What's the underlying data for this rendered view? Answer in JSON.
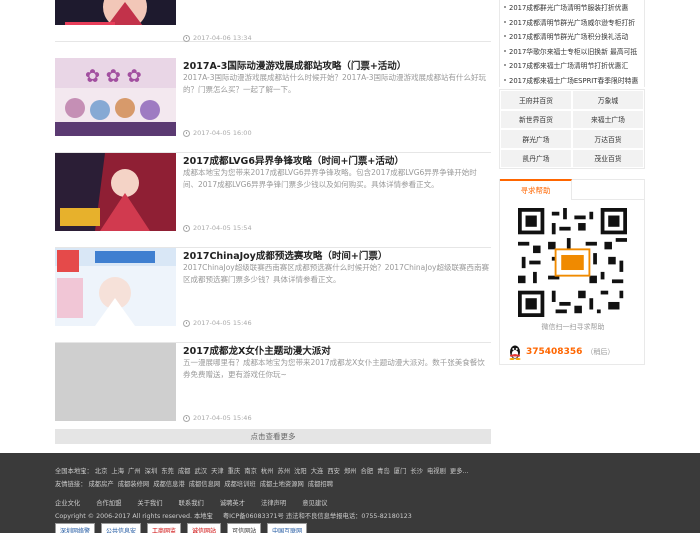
{
  "articles": [
    {
      "title": "",
      "summary": "",
      "date": "2017-04-06 13:34"
    },
    {
      "title": "2017A-3国际动漫游戏展成都站攻略（门票+活动）",
      "summary": "2017A-3国际动漫游戏展成都站什么时候开始？2017A-3国际动漫游戏展成都站有什么好玩的？门票怎么买？一起了解一下。",
      "date": "2017-04-05 16:00"
    },
    {
      "title": "2017成都LVG6异界争锋攻略（时间+门票+活动）",
      "summary": "成都本地宝为您带来2017成都LVG6异界争锋攻略。包含2017成都LVG6异界争锋开始时间、2017成都LVG6异界争锋门票多少钱以及如何购买。具体详情参看正文。",
      "date": "2017-04-05 15:54"
    },
    {
      "title": "2017ChinaJoy成都预选赛攻略（时间+门票）",
      "summary": "2017ChinaJoy超级联赛西南赛区成都预选赛什么时候开始？2017ChinaJoy超级联赛西南赛区成都预选赛门票多少钱？具体详情参看正文。",
      "date": "2017-04-05 15:46"
    },
    {
      "title": "2017成都龙X女仆主题动漫大派对",
      "summary": "五一漫展哪里有？成都本地宝为您带来2017成都龙X女仆主题动漫大派对。数千张美食餐饮券免费赠送，更有游戏任你玩~",
      "date": "2017-04-05 15:46"
    }
  ],
  "load_more": "点击查看更多",
  "sidebar": {
    "news": [
      "2017成都群光广场清明节服装打折优惠",
      "2017成都清明节群光广场威尔逊专柜打折",
      "2017成都清明节群光广场积分换礼活动",
      "2017华歌尔来福士专柜以旧换新 最高可抵",
      "2017成都来福士广场清明节打折优惠汇",
      "2017成都来福士广场ESPRIT春季限时特惠"
    ],
    "malls": [
      "王府井百货",
      "万象城",
      "新世界百货",
      "来福士广场",
      "群光广场",
      "万达百货",
      "凯丹广场",
      "茂业百货"
    ],
    "help": {
      "tab": "寻求帮助",
      "qr_caption": "微信扫一扫寻求帮助",
      "qq": "375408356",
      "qq_note": "（稍后）"
    }
  },
  "footer": {
    "cities_label": "全国本地宝：",
    "cities": [
      "北京",
      "上海",
      "广州",
      "深圳",
      "东莞",
      "成都",
      "武汉",
      "天津",
      "重庆",
      "南京",
      "杭州",
      "苏州",
      "沈阳",
      "大连",
      "西安",
      "郑州",
      "合肥",
      "青岛",
      "厦门",
      "长沙",
      "电视剧",
      "更多..."
    ],
    "friends_label": "友情链接：",
    "friends": [
      "成都房产",
      "成都装修网",
      "成都信息港",
      "成都信息网",
      "成都培训班",
      "成都土地资源网",
      "成都招聘"
    ],
    "links": [
      "企业文化",
      "合作加盟",
      "关于我们",
      "联系我们",
      "诚聘英才",
      "法律声明",
      "意见建议"
    ],
    "copyright": "Copyright © 2006-2017 All rights reserved. 本地宝",
    "icp": "粤ICP备06083371号 违法和不良信息举报电话：0755-82180123",
    "badges": [
      "深圳网络警",
      "公共信息安",
      "工商网监",
      "诚信网站",
      "可信网站",
      "中国互联网"
    ]
  },
  "colors": {
    "accent": "#ff6600",
    "footer_bg": "#3a3a3a"
  }
}
